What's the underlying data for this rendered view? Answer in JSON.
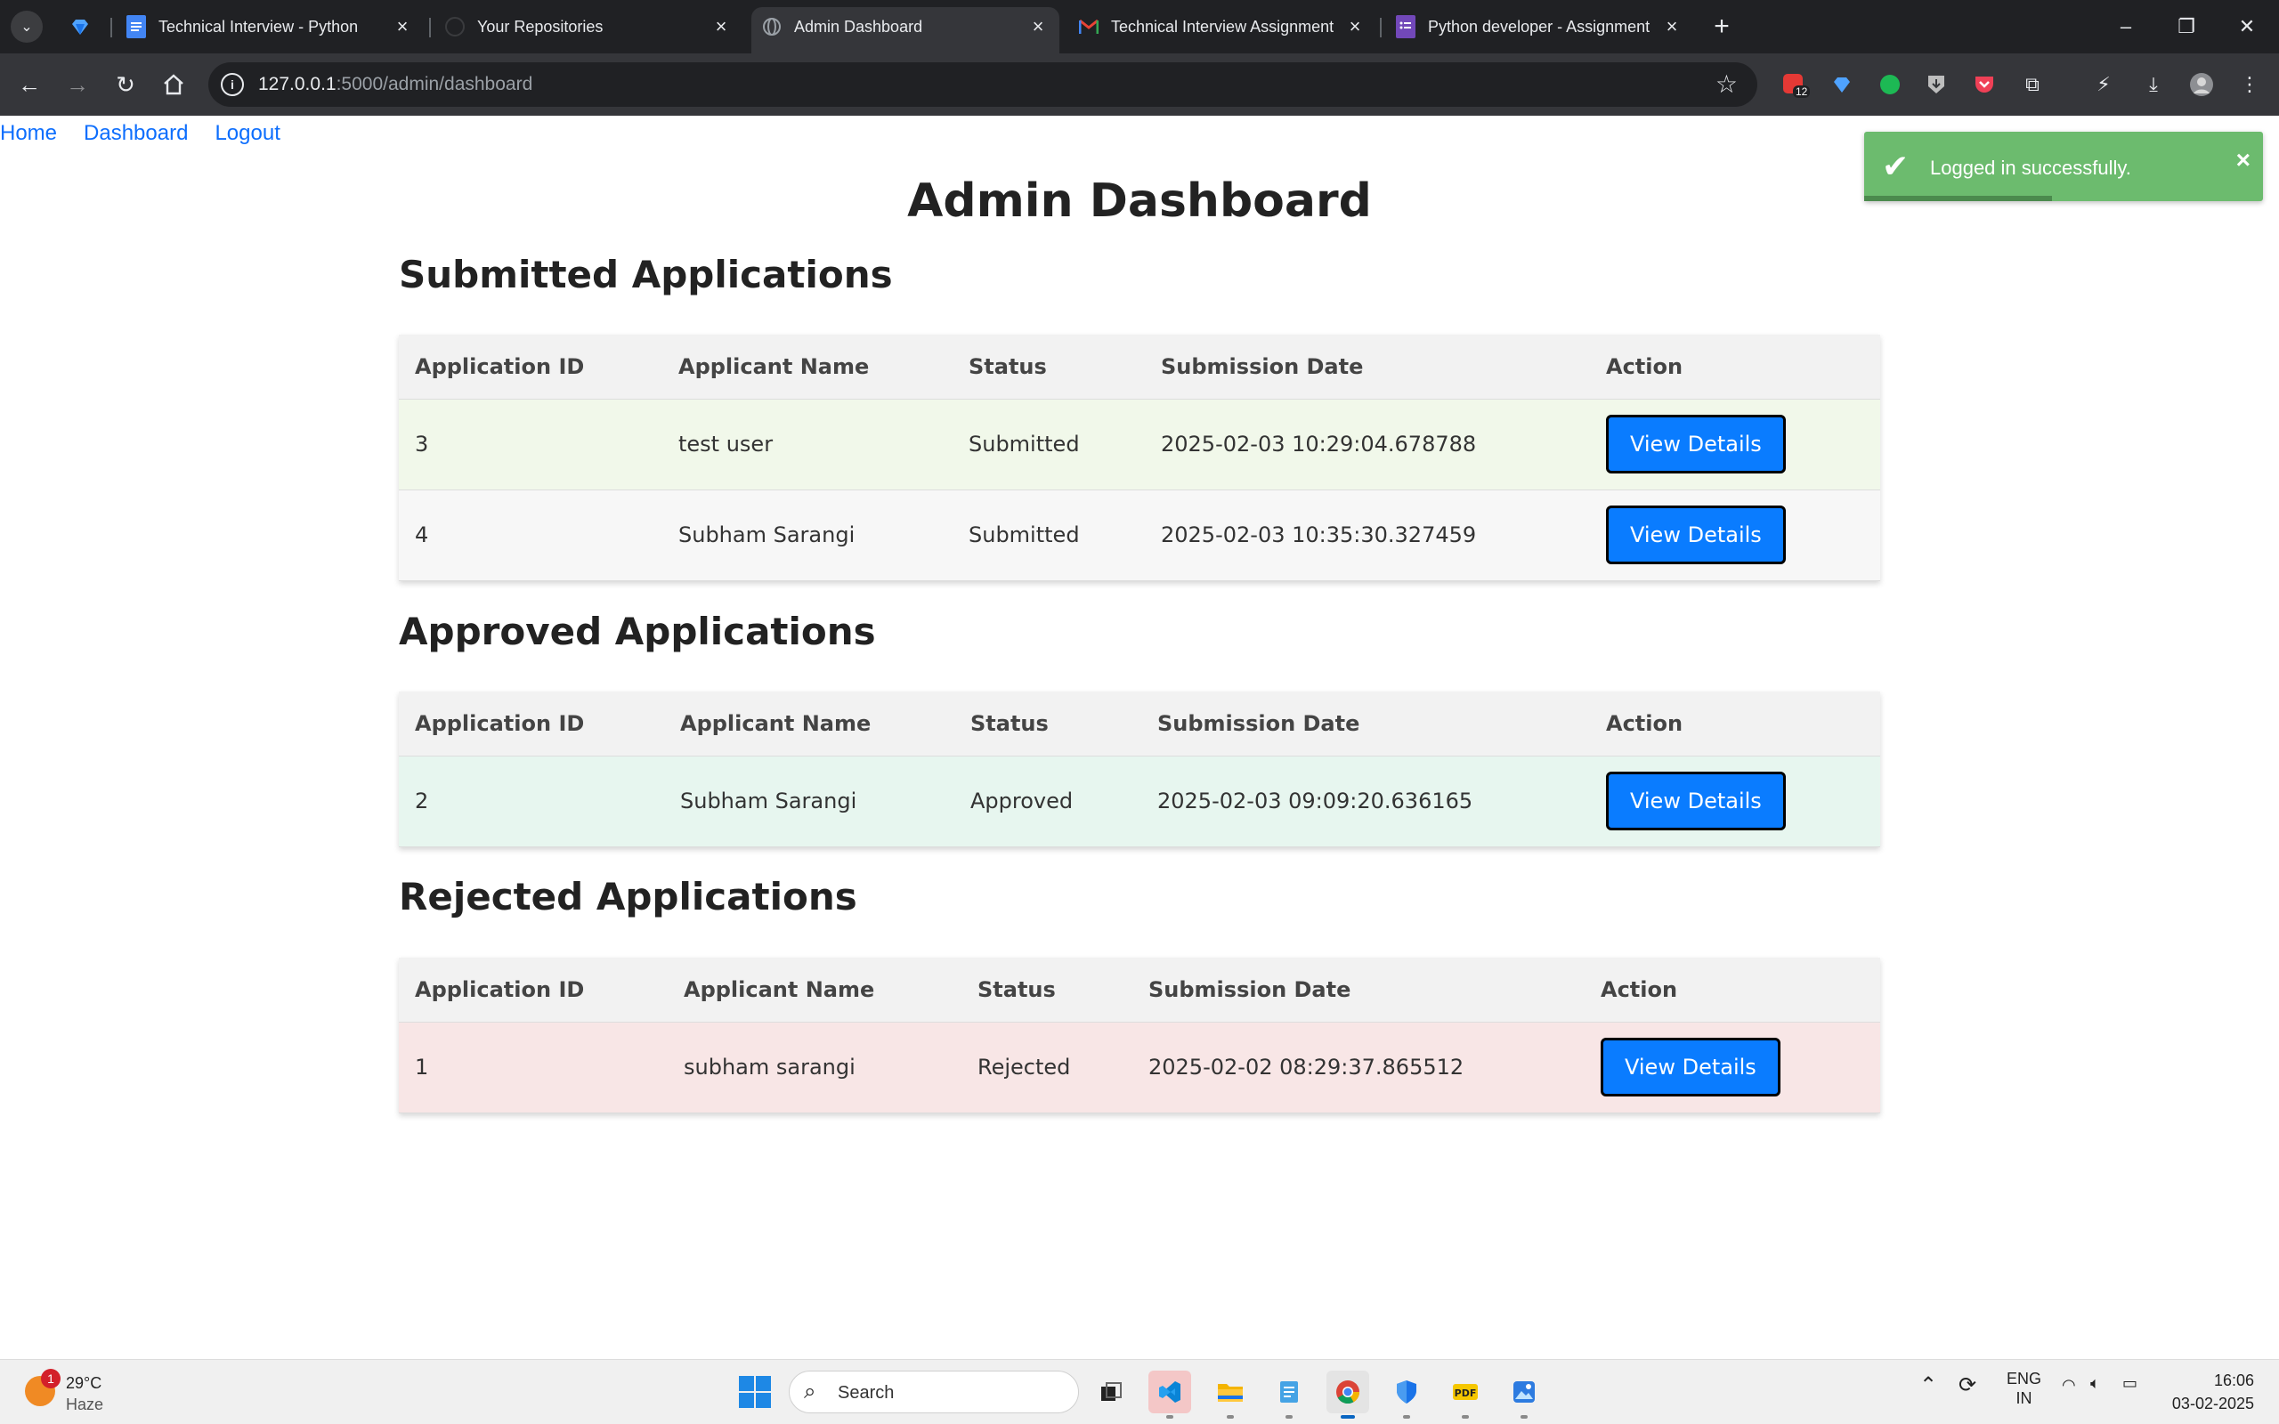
{
  "browser": {
    "tabs": [
      {
        "title": "Technical Interview - Python",
        "icon": "google-docs-icon",
        "active": false
      },
      {
        "title": "Your Repositories",
        "icon": "github-icon",
        "active": false
      },
      {
        "title": "Admin Dashboard",
        "icon": "globe-icon",
        "active": true
      },
      {
        "title": "Technical Interview Assignment",
        "icon": "gmail-icon",
        "active": false
      },
      {
        "title": "Python developer - Assignment",
        "icon": "google-forms-icon",
        "active": false
      }
    ],
    "url_host": "127.0.0.1",
    "url_path": ":5000/admin/dashboard",
    "extension_badge": "12"
  },
  "nav": {
    "home": "Home",
    "dashboard": "Dashboard",
    "logout": "Logout"
  },
  "toast": {
    "message": "Logged in successfully.",
    "close": "×",
    "progress": 0.47
  },
  "title": "Admin Dashboard",
  "sections": {
    "submitted": {
      "heading": "Submitted Applications",
      "columns": [
        "Application ID",
        "Applicant Name",
        "Status",
        "Submission Date",
        "Action"
      ],
      "rows": [
        {
          "id": "3",
          "name": "test user",
          "status": "Submitted",
          "date": "2025-02-03 10:29:04.678788",
          "action": "View Details"
        },
        {
          "id": "4",
          "name": "Subham Sarangi",
          "status": "Submitted",
          "date": "2025-02-03 10:35:30.327459",
          "action": "View Details"
        }
      ]
    },
    "approved": {
      "heading": "Approved Applications",
      "columns": [
        "Application ID",
        "Applicant Name",
        "Status",
        "Submission Date",
        "Action"
      ],
      "rows": [
        {
          "id": "2",
          "name": "Subham Sarangi",
          "status": "Approved",
          "date": "2025-02-03 09:09:20.636165",
          "action": "View Details"
        }
      ]
    },
    "rejected": {
      "heading": "Rejected Applications",
      "columns": [
        "Application ID",
        "Applicant Name",
        "Status",
        "Submission Date",
        "Action"
      ],
      "rows": [
        {
          "id": "1",
          "name": "subham sarangi",
          "status": "Rejected",
          "date": "2025-02-02 08:29:37.865512",
          "action": "View Details"
        }
      ]
    }
  },
  "taskbar": {
    "weather_temp": "29°C",
    "weather_cond": "Haze",
    "weather_badge": "1",
    "search_placeholder": "Search",
    "lang_1": "ENG",
    "lang_2": "IN",
    "time": "16:06",
    "date": "03-02-2025"
  },
  "colors": {
    "link": "#0d6efd",
    "button": "#0a7cff",
    "toast": "#6cbb6e",
    "submitted_row": "#f1f8ea",
    "approved_row": "#e7f6ef",
    "rejected_row": "#f8e6e6"
  }
}
